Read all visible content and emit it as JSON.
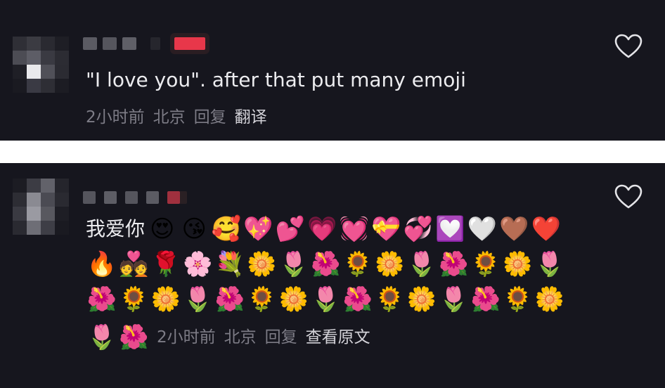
{
  "comments": [
    {
      "text": "\"I love you\". after that put many emoji",
      "time": "2小时前",
      "location": "北京",
      "reply_label": "回复",
      "extra_label": "翻译"
    },
    {
      "text_prefix": "我爱你",
      "emoji_line_1": [
        "😍",
        "😘",
        "🥰",
        "💖",
        "💕",
        "💗",
        "💓",
        "💝",
        "💞",
        "💟",
        "🤍",
        "🤎",
        "❤️"
      ],
      "emoji_line_2": [
        "🔥",
        "💑",
        "🌹",
        "🌸",
        "💐",
        "🌼",
        "🌷",
        "🌺",
        "🌻",
        "🌼",
        "🌷",
        "🌺",
        "🌻",
        "🌼",
        "🌷"
      ],
      "emoji_line_3": [
        "🌺",
        "🌻",
        "🌼",
        "🌷",
        "🌺",
        "🌻",
        "🌼",
        "🌷",
        "🌺",
        "🌻",
        "🌼",
        "🌷",
        "🌺",
        "🌻",
        "🌼"
      ],
      "emoji_line_4": [
        "🌷",
        "🌺"
      ],
      "time": "2小时前",
      "location": "北京",
      "reply_label": "回复",
      "extra_label": "查看原文"
    }
  ],
  "colors": {
    "background": "#16161e",
    "text": "#ececef",
    "muted": "#7d7c86",
    "action": "#d3d2d8",
    "redacted_red": "#e8374a"
  },
  "icons": {
    "like": "heart-outline-icon"
  }
}
